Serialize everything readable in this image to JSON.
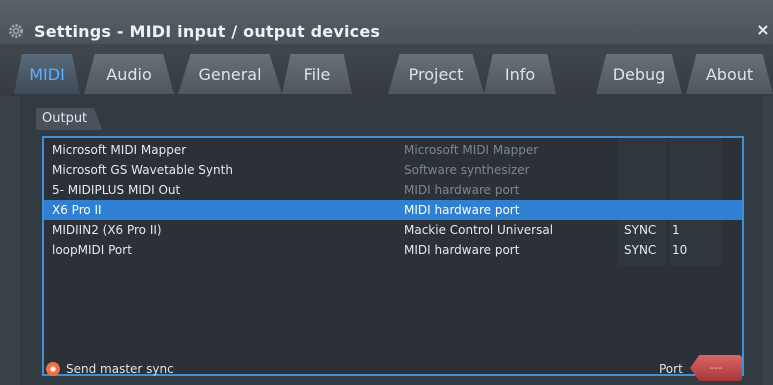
{
  "window": {
    "title": "Settings - MIDI input / output devices",
    "close_glyph": "×"
  },
  "tabs": [
    {
      "label": "MIDI",
      "active": true
    },
    {
      "label": "Audio",
      "active": false
    },
    {
      "label": "General",
      "active": false
    },
    {
      "label": "File",
      "active": false
    },
    {
      "label": "Project",
      "active": false
    },
    {
      "label": "Info",
      "active": false
    },
    {
      "label": "Debug",
      "active": false
    },
    {
      "label": "About",
      "active": false
    }
  ],
  "output": {
    "section_label": "Output",
    "devices": [
      {
        "name": "Microsoft MIDI Mapper",
        "type": "Microsoft MIDI Mapper",
        "sync": "",
        "port": "",
        "dim": true
      },
      {
        "name": "Microsoft GS Wavetable Synth",
        "type": "Software synthesizer",
        "sync": "",
        "port": "",
        "dim": true
      },
      {
        "name": "5- MIDIPLUS MIDI Out",
        "type": "MIDI hardware port",
        "sync": "",
        "port": "",
        "dim": true
      },
      {
        "name": "X6 Pro II",
        "type": "MIDI hardware port",
        "sync": "",
        "port": "",
        "selected": true
      },
      {
        "name": "MIDIIN2 (X6 Pro II)",
        "type": "Mackie Control Universal",
        "sync": "SYNC",
        "port": "1"
      },
      {
        "name": "loopMIDI Port",
        "type": "MIDI hardware port",
        "sync": "SYNC",
        "port": "10"
      }
    ]
  },
  "footer": {
    "send_master_sync": "Send master sync",
    "port_label": "Port",
    "port_value": "---"
  },
  "colors": {
    "accent": "#2f7fd3",
    "active_tab_text": "#5ab0ff",
    "sync_indicator": "#f07040",
    "port_field": "#c04848"
  },
  "icons": {
    "app": "gear-icon",
    "close": "close-icon",
    "sync": "radio-indicator-icon"
  }
}
